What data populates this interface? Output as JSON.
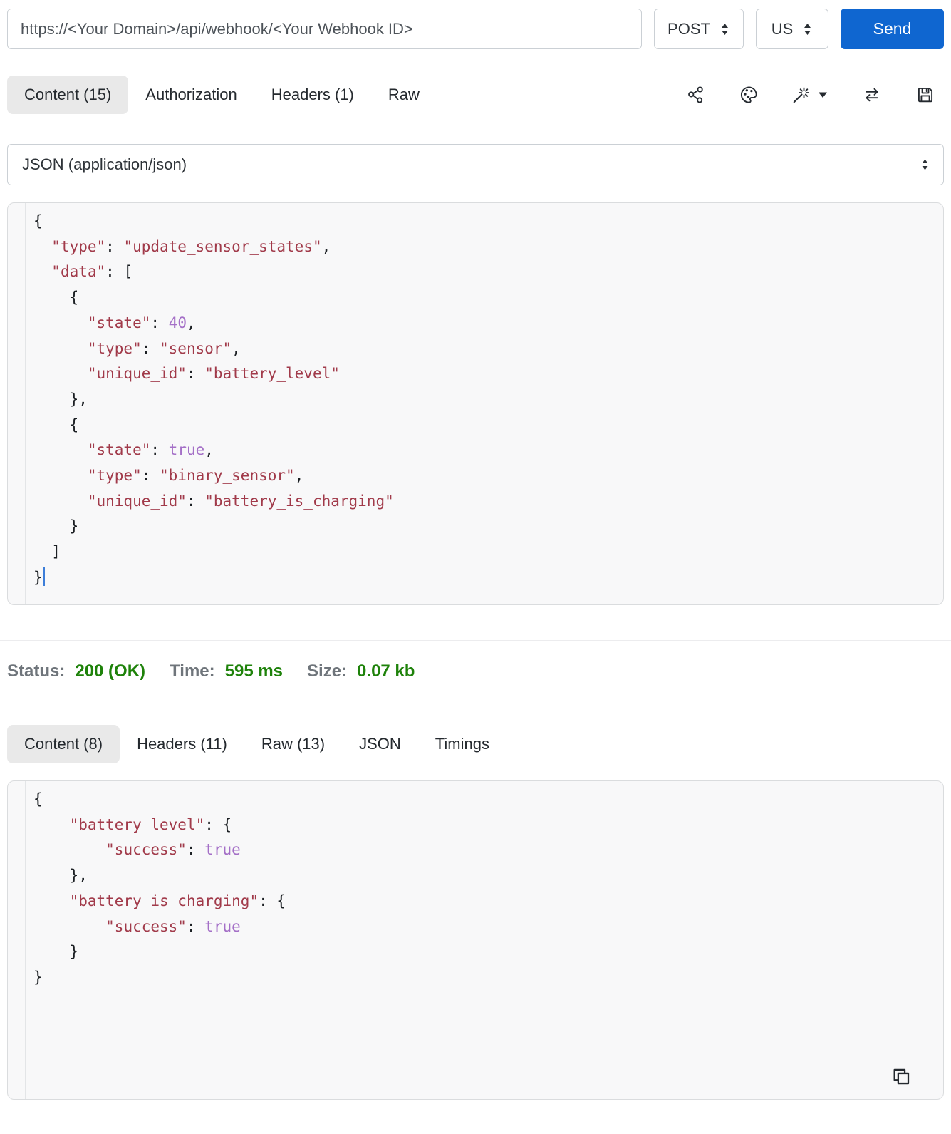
{
  "request_bar": {
    "url_value": "https://<Your Domain>/api/webhook/<Your Webhook ID>",
    "method": "POST",
    "region": "US",
    "send_label": "Send"
  },
  "request_tabs": {
    "content": "Content (15)",
    "authorization": "Authorization",
    "headers": "Headers (1)",
    "raw": "Raw"
  },
  "toolbar_icons": [
    "share-icon",
    "palette-icon",
    "magic-wand-icon",
    "caret-down-icon",
    "swap-arrows-icon",
    "save-icon"
  ],
  "body_type": "JSON (application/json)",
  "request_code": {
    "cursor_after_line": 15,
    "lines": [
      [
        [
          "{",
          "p"
        ]
      ],
      [
        [
          "  ",
          "p"
        ],
        [
          "\"type\"",
          "s"
        ],
        [
          ": ",
          "p"
        ],
        [
          "\"update_sensor_states\"",
          "s"
        ],
        [
          ",",
          "p"
        ]
      ],
      [
        [
          "  ",
          "p"
        ],
        [
          "\"data\"",
          "s"
        ],
        [
          ": [",
          "p"
        ]
      ],
      [
        [
          "    {",
          "p"
        ]
      ],
      [
        [
          "      ",
          "p"
        ],
        [
          "\"state\"",
          "s"
        ],
        [
          ": ",
          "p"
        ],
        [
          "40",
          "n"
        ],
        [
          ",",
          "p"
        ]
      ],
      [
        [
          "      ",
          "p"
        ],
        [
          "\"type\"",
          "s"
        ],
        [
          ": ",
          "p"
        ],
        [
          "\"sensor\"",
          "s"
        ],
        [
          ",",
          "p"
        ]
      ],
      [
        [
          "      ",
          "p"
        ],
        [
          "\"unique_id\"",
          "s"
        ],
        [
          ": ",
          "p"
        ],
        [
          "\"battery_level\"",
          "s"
        ]
      ],
      [
        [
          "    },",
          "p"
        ]
      ],
      [
        [
          "    {",
          "p"
        ]
      ],
      [
        [
          "      ",
          "p"
        ],
        [
          "\"state\"",
          "s"
        ],
        [
          ": ",
          "p"
        ],
        [
          "true",
          "n"
        ],
        [
          ",",
          "p"
        ]
      ],
      [
        [
          "      ",
          "p"
        ],
        [
          "\"type\"",
          "s"
        ],
        [
          ": ",
          "p"
        ],
        [
          "\"binary_sensor\"",
          "s"
        ],
        [
          ",",
          "p"
        ]
      ],
      [
        [
          "      ",
          "p"
        ],
        [
          "\"unique_id\"",
          "s"
        ],
        [
          ": ",
          "p"
        ],
        [
          "\"battery_is_charging\"",
          "s"
        ]
      ],
      [
        [
          "    }",
          "p"
        ]
      ],
      [
        [
          "  ]",
          "p"
        ]
      ],
      [
        [
          "}",
          "p"
        ]
      ]
    ]
  },
  "status_bar": {
    "status_label": "Status:",
    "status_value": "200 (OK)",
    "time_label": "Time:",
    "time_value": "595 ms",
    "size_label": "Size:",
    "size_value": "0.07 kb"
  },
  "response_tabs": {
    "content": "Content (8)",
    "headers": "Headers (11)",
    "raw": "Raw (13)",
    "json": "JSON",
    "timings": "Timings"
  },
  "response_code": {
    "lines": [
      [
        [
          "{",
          "p"
        ]
      ],
      [
        [
          "    ",
          "p"
        ],
        [
          "\"battery_level\"",
          "s"
        ],
        [
          ": {",
          "p"
        ]
      ],
      [
        [
          "        ",
          "p"
        ],
        [
          "\"success\"",
          "s"
        ],
        [
          ": ",
          "p"
        ],
        [
          "true",
          "n"
        ]
      ],
      [
        [
          "    },",
          "p"
        ]
      ],
      [
        [
          "    ",
          "p"
        ],
        [
          "\"battery_is_charging\"",
          "s"
        ],
        [
          ": {",
          "p"
        ]
      ],
      [
        [
          "        ",
          "p"
        ],
        [
          "\"success\"",
          "s"
        ],
        [
          ": ",
          "p"
        ],
        [
          "true",
          "n"
        ]
      ],
      [
        [
          "    }",
          "p"
        ]
      ],
      [
        [
          "}",
          "p"
        ]
      ]
    ]
  },
  "colors": {
    "accent_blue": "#0f66d0",
    "status_green": "#1e820a",
    "string_red": "#a13a4a",
    "atom_purple": "#a46fc7"
  }
}
